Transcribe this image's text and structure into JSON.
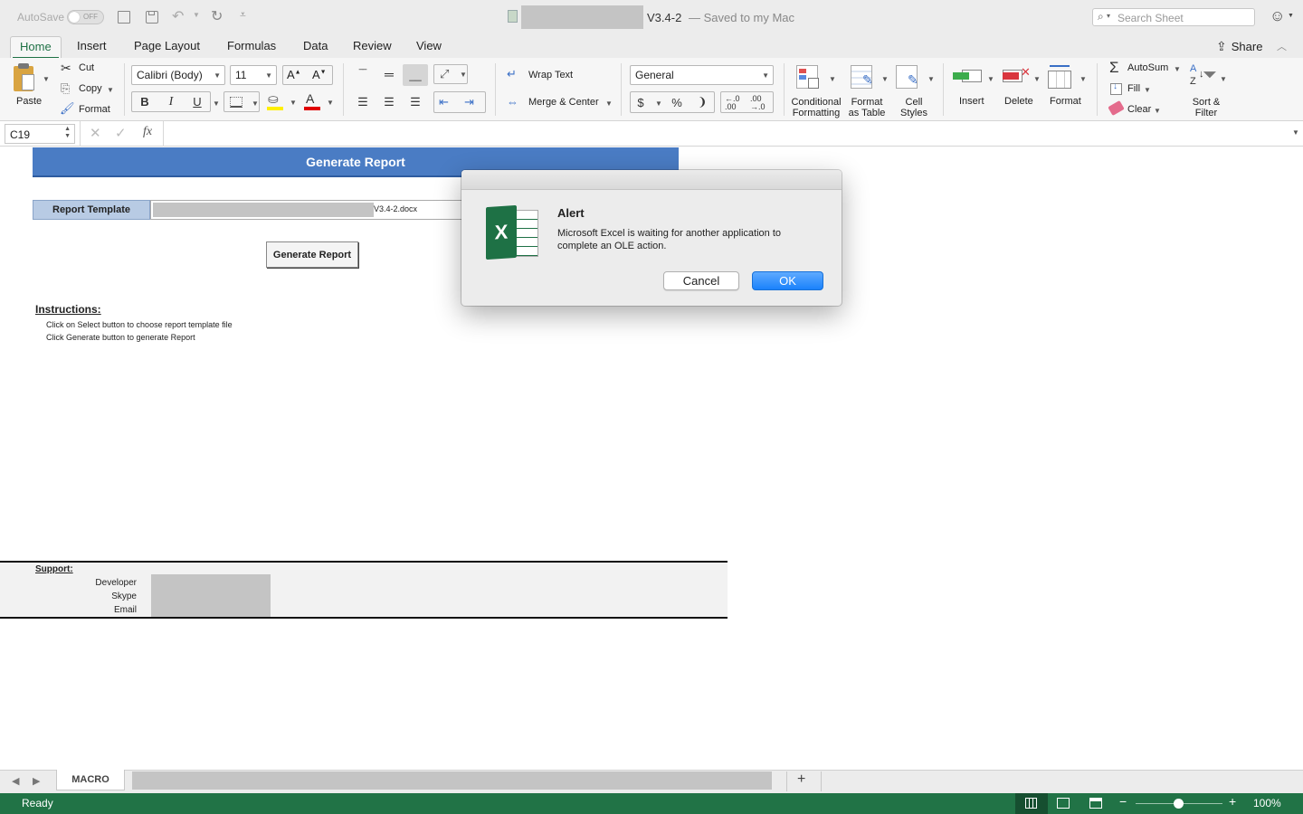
{
  "titlebar": {
    "autosave_label": "AutoSave",
    "autosave_state": "OFF",
    "doc_title": "V3.4-2",
    "doc_status": "— Saved to my Mac",
    "search_placeholder": "Search Sheet"
  },
  "tabs": [
    "Home",
    "Insert",
    "Page Layout",
    "Formulas",
    "Data",
    "Review",
    "View"
  ],
  "share_label": "Share",
  "ribbon": {
    "paste": "Paste",
    "cut": "Cut",
    "copy": "Copy",
    "format_painter": "Format",
    "font_name": "Calibri (Body)",
    "font_size": "11",
    "bold": "B",
    "italic": "I",
    "underline": "U",
    "wrap_text": "Wrap Text",
    "merge_center": "Merge & Center",
    "number_format": "General",
    "currency": "$",
    "percent": "%",
    "comma": "❩",
    "conditional_formatting": "Conditional Formatting",
    "conditional_line1": "Conditional",
    "conditional_line2": "Formatting",
    "format_as_table_line1": "Format",
    "format_as_table_line2": "as Table",
    "cell_styles_line1": "Cell",
    "cell_styles_line2": "Styles",
    "insert": "Insert",
    "delete": "Delete",
    "format": "Format",
    "autosum": "AutoSum",
    "fill": "Fill",
    "clear": "Clear",
    "sort_line1": "Sort &",
    "sort_line2": "Filter"
  },
  "formula_bar": {
    "name_box": "C19",
    "fx": "fx",
    "content": ""
  },
  "sheet": {
    "header": "Generate Report",
    "report_template_label": "Report Template",
    "template_file": "V3.4-2.docx",
    "generate_button": "Generate Report",
    "instructions_title": "Instructions:",
    "instructions": [
      "Click on Select button to choose report template file",
      "Click Generate button to generate Report"
    ],
    "support_title": "Support:",
    "support_fields": [
      "Developer",
      "Skype",
      "Email"
    ]
  },
  "dialog": {
    "title": "Alert",
    "message": "Microsoft Excel is waiting for another application to complete an OLE action.",
    "message_line1": "Microsoft Excel is waiting for another application to",
    "message_line2": "complete an OLE action.",
    "cancel": "Cancel",
    "ok": "OK",
    "icon_letter": "X"
  },
  "sheet_tabs": {
    "active": "MACRO",
    "add": "+"
  },
  "status": {
    "text": "Ready",
    "zoom": "100%"
  },
  "colors": {
    "accent_green": "#217346",
    "header_blue": "#4a7cc4",
    "label_blue": "#b8cbe4",
    "ok_blue": "#1a82fb"
  }
}
